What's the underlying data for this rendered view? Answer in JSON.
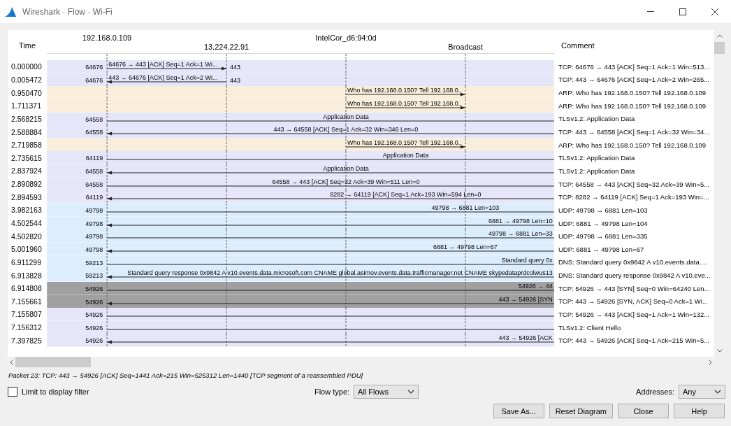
{
  "window": {
    "title": "Wireshark · Flow · Wi-Fi"
  },
  "diagram": {
    "time_heading": "Time",
    "comment_heading": "Comment",
    "nodes": [
      {
        "label": "192.168.0.109"
      },
      {
        "label": "13.224.22.91"
      },
      {
        "label": "IntelCor_d6:94:0d"
      },
      {
        "label": "Broadcast"
      }
    ],
    "rows": [
      {
        "kind": "out1",
        "time": "0.000000",
        "port": "64676",
        "dest_port": "443",
        "label": "64676 → 443 [ACK] Seq=1 Ack=1 Wi...",
        "comment": "TCP: 64676 → 443 [ACK] Seq=1 Ack=1 Win=513...",
        "color": "#e6e6fb",
        "selected": false
      },
      {
        "kind": "in1",
        "time": "0.005472",
        "port": "64676",
        "dest_port": "443",
        "label": "443 → 64676 [ACK] Seq=1 Ack=2 Wi...",
        "comment": "TCP: 443 → 64676 [ACK] Seq=1 Ack=2 Win=265...",
        "color": "#e6e6fb",
        "selected": false
      },
      {
        "kind": "arp",
        "time": "0.950470",
        "label": "Who has 192.168.0.150? Tell 192.168.0..",
        "comment": "ARP: Who has 192.168.0.150? Tell 192.168.0.109",
        "color": "#f8eedb",
        "selected": false
      },
      {
        "kind": "arp",
        "time": "1.711371",
        "label": "Who has 192.168.0.150? Tell 192.168.0..",
        "comment": "ARP: Who has 192.168.0.150? Tell 192.168.0.109",
        "color": "#f8eedb",
        "selected": false
      },
      {
        "kind": "out4",
        "time": "2.568215",
        "port": "64558",
        "label": "Application Data",
        "comment": "TLSv1.2: Application Data",
        "color": "#e6e6fb",
        "selected": false
      },
      {
        "kind": "in4",
        "time": "2.588884",
        "port": "64558",
        "label": "443 → 64558 [ACK] Seq=1 Ack=32 Win=346 Len=0",
        "comment": "TCP: 443 → 64558 [ACK] Seq=1 Ack=32 Win=34...",
        "color": "#e6e6fb",
        "selected": false
      },
      {
        "kind": "arp",
        "time": "2.719858",
        "label": "Who has 192.168.0.150? Tell 192.168.0..",
        "comment": "ARP: Who has 192.168.0.150? Tell 192.168.0.109",
        "color": "#f8eedb",
        "selected": false
      },
      {
        "kind": "out5",
        "time": "2.735615",
        "port": "64119",
        "label": "Application Data",
        "comment": "TLSv1.2: Application Data",
        "color": "#e6e6fb",
        "selected": false
      },
      {
        "kind": "in4",
        "time": "2.837924",
        "port": "64558",
        "label": "Application Data",
        "comment": "TLSv1.2: Application Data",
        "color": "#e6e6fb",
        "selected": false
      },
      {
        "kind": "out4",
        "time": "2.890892",
        "port": "64558",
        "label": "64558 → 443 [ACK] Seq=32 Ack=39 Win=511 Len=0",
        "comment": "TCP: 64558 → 443 [ACK] Seq=32 Ack=39 Win=5...",
        "color": "#e6e6fb",
        "selected": false
      },
      {
        "kind": "in5",
        "time": "2.894593",
        "port": "64119",
        "label": "8282 → 64119 [ACK] Seq=1 Ack=193 Win=594 Len=0",
        "comment": "TCP: 8282 → 64119 [ACK] Seq=1 Ack=193 Win=...",
        "color": "#e6e6fb",
        "selected": false
      },
      {
        "kind": "out6",
        "time": "3.982163",
        "port": "49798",
        "label": "49798 → 6881 Len=103",
        "comment": "UDP: 49798 → 6881 Len=103",
        "color": "#dcedfd",
        "selected": false
      },
      {
        "kind": "in7",
        "time": "4.502544",
        "port": "49798",
        "label": "6881 → 49798 Len=10",
        "comment": "UDP: 6881 → 49798 Len=104",
        "color": "#dcedfd",
        "selected": false
      },
      {
        "kind": "out7",
        "time": "4.502820",
        "port": "49798",
        "label": "49798 → 6881 Len=33",
        "comment": "UDP: 49798 → 6881 Len=335",
        "color": "#dcedfd",
        "selected": false
      },
      {
        "kind": "in6",
        "time": "5.001960",
        "port": "49798",
        "label": "6881 → 49798 Len=67",
        "comment": "UDP: 6881 → 49798 Len=67",
        "color": "#dcedfd",
        "selected": false
      },
      {
        "kind": "out8",
        "time": "6.911299",
        "port": "59213",
        "label": "Standard query 0x",
        "comment": "DNS: Standard query 0x9842 A v10.events.data....",
        "color": "#dcedfd",
        "selected": false
      },
      {
        "kind": "in8",
        "time": "6.913828",
        "port": "59213",
        "label": "Standard query response 0x9842 A v10.events.data.microsoft.com CNAME global.asimov.events.data.trafficmanager.net CNAME skypedataprdcolwus13",
        "comment": "DNS: Standard query response 0x9842 A v10.eve...",
        "color": "#dcedfd",
        "selected": false
      },
      {
        "kind": "out8",
        "time": "6.914808",
        "port": "54926",
        "label": "54926 → 44",
        "comment": "TCP: 54926 → 443 [SYN] Seq=0 Win=64240 Len...",
        "selected": true
      },
      {
        "kind": "in8",
        "time": "7.155661",
        "port": "54926",
        "label": "443 → 54926 [SYN",
        "comment": "TCP: 443 → 54926 [SYN, ACK] Seq=0 Ack=1 Wi...",
        "selected": true
      },
      {
        "kind": "out8",
        "time": "7.155807",
        "port": "54926",
        "comment": "TCP: 54926 → 443 [ACK] Seq=1 Ack=1 Win=132...",
        "color": "#e6e6fb",
        "selected": false
      },
      {
        "kind": "out8",
        "time": "7.156312",
        "port": "54926",
        "comment": "TLSv1.2: Client Hello",
        "color": "#e6e6fb",
        "selected": false
      },
      {
        "kind": "in8",
        "time": "7.397825",
        "port": "54926",
        "label": "443 → 54926 [ACK",
        "comment": "TCP: 443 → 54926 [ACK] Seq=1 Ack=215 Win=5...",
        "color": "#e6e6fb",
        "selected": false
      }
    ]
  },
  "status": "Packet 23: TCP: 443 → 54926 [ACK] Seq=1441 Ack=215 Win=525312 Len=1440 [TCP segment of a reassembled PDU]",
  "limit_to_display_filter": {
    "label": "Limit to display filter",
    "checked": false
  },
  "flow_type": {
    "label": "Flow type:",
    "value": "All Flows"
  },
  "addresses": {
    "label": "Addresses:",
    "value": "Any"
  },
  "buttons": [
    "Save As...",
    "Reset Diagram",
    "Close",
    "Help"
  ]
}
